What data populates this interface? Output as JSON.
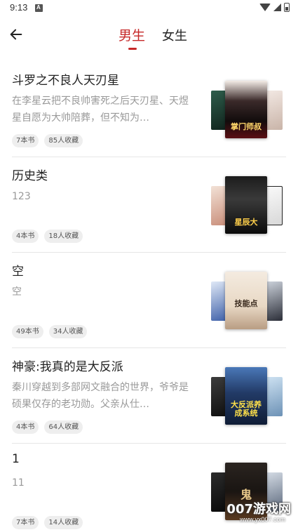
{
  "status_bar": {
    "time": "9:13",
    "notification_icon": "a-icon"
  },
  "header": {
    "tabs": [
      {
        "label": "男生",
        "active": true
      },
      {
        "label": "女生",
        "active": false
      }
    ],
    "accent_color": "#c62828"
  },
  "items": [
    {
      "title": "斗罗之不良人天刃星",
      "description": "在李星云把不良帅害死之后天刃星、天煜星自愿为大帅陪葬，但不知为…",
      "books": "7本书",
      "collected": "85人收藏",
      "cover_title": "掌门师叔"
    },
    {
      "title": "历史类",
      "description": "123",
      "books": "4本书",
      "collected": "18人收藏",
      "cover_title": "星辰大"
    },
    {
      "title": "空",
      "description": "空",
      "books": "49本书",
      "collected": "34人收藏",
      "cover_title": "技能点"
    },
    {
      "title": "神豪:我真的是大反派",
      "description": "秦川穿越到多部网文融合的世界，爷爷是硕果仅存的老功勋。父亲从仕…",
      "books": "4本书",
      "collected": "64人收藏",
      "cover_title": "大反派养成系统"
    },
    {
      "title": "1",
      "description": "11",
      "books": "7本书",
      "collected": "14人收藏",
      "cover_title": "鬼"
    }
  ],
  "watermark": {
    "top": "007游戏网",
    "bottom": "www.yx007.com"
  }
}
